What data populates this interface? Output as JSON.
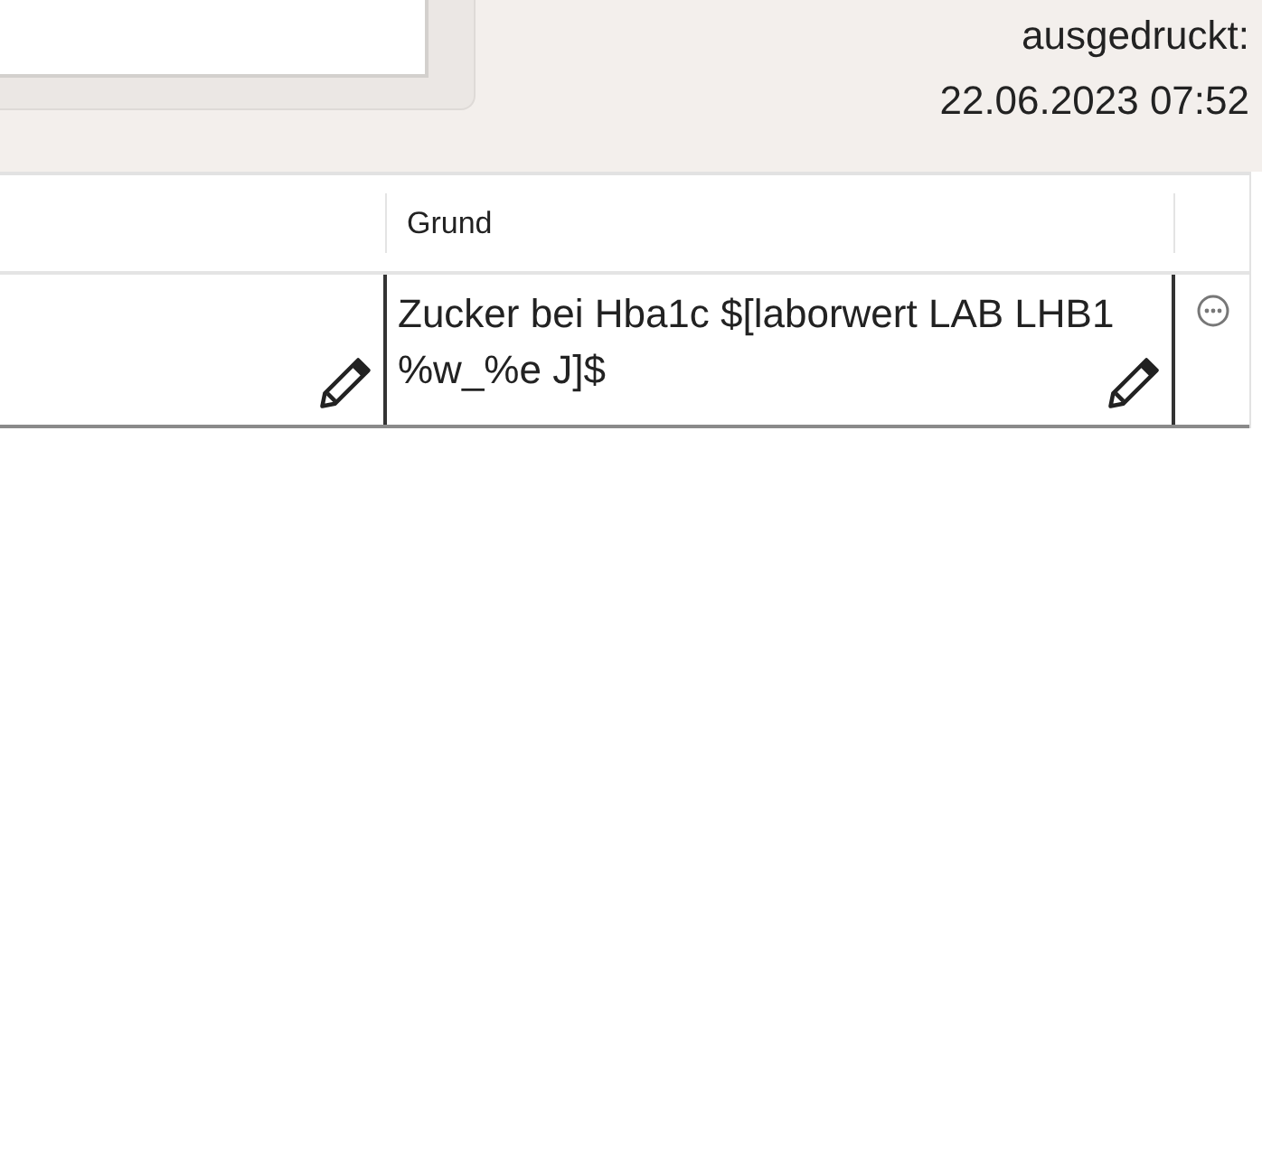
{
  "print_info": {
    "label": "ausgedruckt:",
    "timestamp": "22.06.2023 07:52"
  },
  "table": {
    "columns": [
      "Grund"
    ],
    "rows": [
      {
        "grund": "Zucker bei Hba1c $[laborwert LAB LHB1 %w_%e J]$"
      }
    ]
  }
}
